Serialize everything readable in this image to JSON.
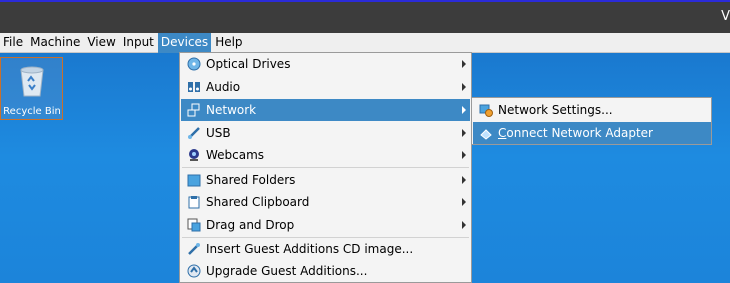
{
  "window": {
    "title_fragment": "V"
  },
  "menubar": [
    "File",
    "Machine",
    "View",
    "Input",
    "Devices",
    "Help"
  ],
  "desktop": {
    "recycle_bin_label": "Recycle Bin"
  },
  "devices_menu": {
    "optical": "Optical Drives",
    "audio": "Audio",
    "network": "Network",
    "usb": "USB",
    "webcams": "Webcams",
    "shared_folders": "Shared Folders",
    "shared_clipboard": "Shared Clipboard",
    "drag_drop": "Drag and Drop",
    "insert_ga": "Insert Guest Additions CD image...",
    "upgrade_ga": "Upgrade Guest Additions..."
  },
  "network_submenu": {
    "settings": "Network Settings...",
    "connect_first": "C",
    "connect_rest": "onnect Network Adapter"
  },
  "colors": {
    "highlight": "#3d89c5",
    "desktop": "#1c80d4",
    "titlebar": "#3c3c3c"
  }
}
